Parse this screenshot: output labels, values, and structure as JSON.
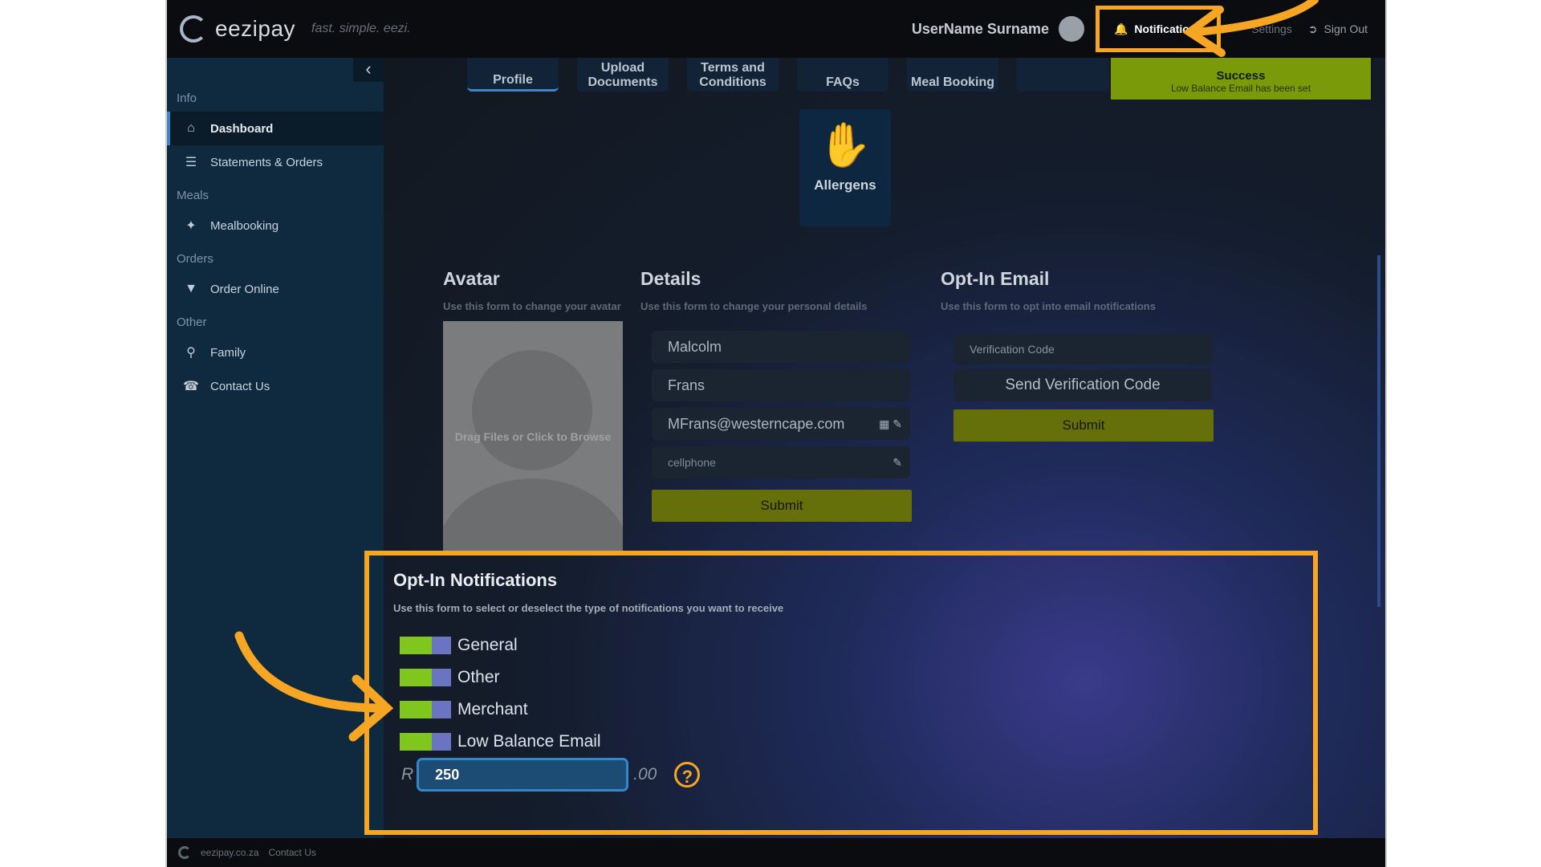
{
  "brand": {
    "name": "eezipay",
    "tagline": "fast. simple. eezi."
  },
  "topbar": {
    "user": "UserName Surname",
    "notifications": "Notifications",
    "settings": "Settings",
    "signout": "Sign Out"
  },
  "sidebar": {
    "sections": [
      {
        "title": "Info",
        "items": [
          {
            "label": "Dashboard",
            "icon": "home-icon"
          },
          {
            "label": "Statements & Orders",
            "icon": "list-icon"
          }
        ]
      },
      {
        "title": "Meals",
        "items": [
          {
            "label": "Mealbooking",
            "icon": "cutlery-icon"
          }
        ]
      },
      {
        "title": "Orders",
        "items": [
          {
            "label": "Order Online",
            "icon": "basket-icon"
          }
        ]
      },
      {
        "title": "Other",
        "items": [
          {
            "label": "Family",
            "icon": "family-icon"
          },
          {
            "label": "Contact Us",
            "icon": "phone-icon"
          }
        ]
      }
    ]
  },
  "tabs": [
    "Profile",
    "Upload Documents",
    "Terms and Conditions",
    "FAQs",
    "Meal Booking",
    ""
  ],
  "toast": {
    "title": "Success",
    "message": "Low Balance Email has been set"
  },
  "allergens": {
    "label": "Allergens"
  },
  "avatar": {
    "title": "Avatar",
    "subtitle": "Use this form to change your avatar",
    "dropzone": "Drag Files or Click to Browse"
  },
  "details": {
    "title": "Details",
    "subtitle": "Use this form to change your personal details",
    "first_name": "Malcolm",
    "last_name": "Frans",
    "email": "MFrans@westerncape.com",
    "cellphone_placeholder": "cellphone",
    "submit": "Submit"
  },
  "optin_email": {
    "title": "Opt-In Email",
    "subtitle": "Use this form to opt into email notifications",
    "code_placeholder": "Verification Code",
    "send_code": "Send Verification Code",
    "submit": "Submit"
  },
  "optin_notifications": {
    "title": "Opt-In Notifications",
    "subtitle": "Use this form to select or deselect the type of notifications you want to receive",
    "toggles": [
      {
        "label": "General",
        "on": true
      },
      {
        "label": "Other",
        "on": true
      },
      {
        "label": "Merchant",
        "on": true
      },
      {
        "label": "Low Balance Email",
        "on": true
      }
    ],
    "currency": "R",
    "amount": "250",
    "cents": ".00",
    "help": "?"
  },
  "footer": {
    "site": "eezipay.co.za",
    "contact": "Contact Us"
  },
  "colors": {
    "accent_orange": "#f6a623",
    "toggle_on": "#7fc61e",
    "submit_olive": "#66700a"
  }
}
